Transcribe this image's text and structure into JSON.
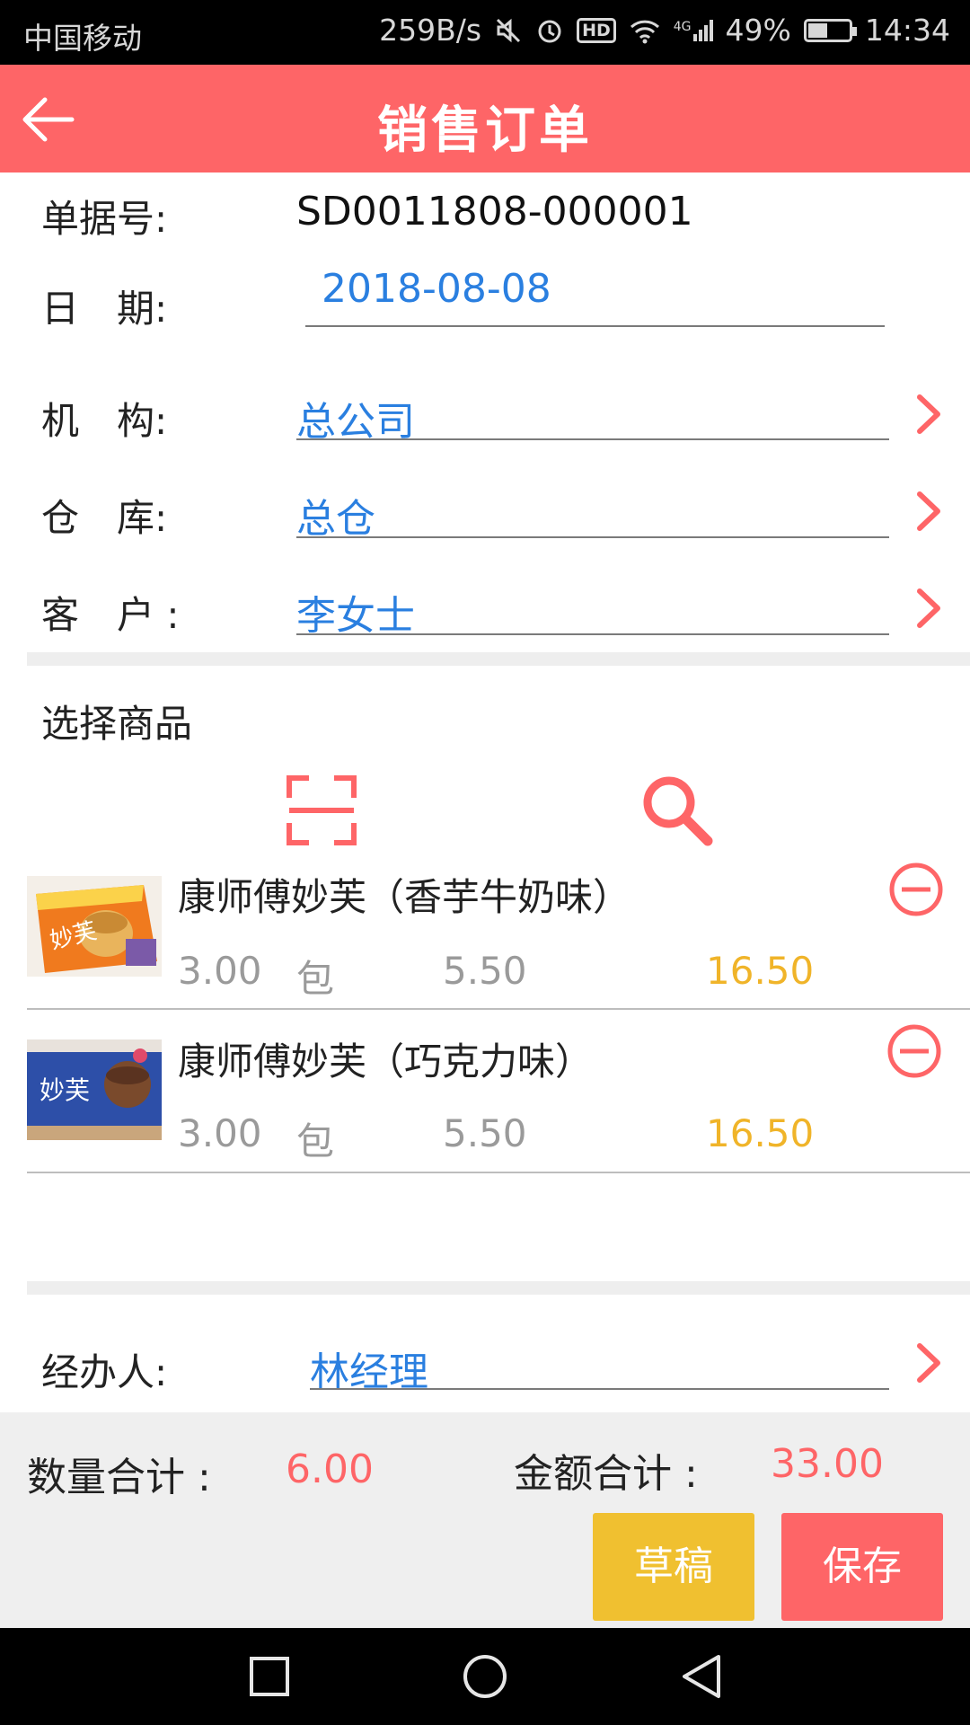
{
  "status_bar": {
    "carrier": "中国移动",
    "net_speed": "259B/s",
    "hd": "HD",
    "signal_type": "4G",
    "battery": "49%",
    "time": "14:34"
  },
  "header": {
    "title": "销售订单"
  },
  "form": {
    "doc_no_label": "单据号:",
    "doc_no_value": "SD0011808-000001",
    "date_label": "日　期:",
    "date_value": "2018-08-08",
    "org_label": "机　构:",
    "org_value": "总公司",
    "warehouse_label": "仓　库:",
    "warehouse_value": "总仓",
    "customer_label": "客　户 :",
    "customer_value": "李女士"
  },
  "goods": {
    "section_label": "选择商品",
    "items": [
      {
        "name": "康师傅妙芙（香芋牛奶味）",
        "qty": "3.00",
        "unit": "包",
        "price": "5.50",
        "amount": "16.50",
        "image_text": "妙芙"
      },
      {
        "name": "康师傅妙芙（巧克力味）",
        "qty": "3.00",
        "unit": "包",
        "price": "5.50",
        "amount": "16.50",
        "image_text": "妙芙"
      }
    ]
  },
  "handler": {
    "label": "经办人:",
    "value": "林经理"
  },
  "totals": {
    "qty_label": "数量合计 :",
    "qty_value": "6.00",
    "amount_label": "金额合计 :",
    "amount_value": "33.00"
  },
  "actions": {
    "draft_label": "草稿",
    "save_label": "保存"
  },
  "colors": {
    "brand": "#fe6567",
    "link_blue": "#2a7fe0",
    "amount_yellow": "#f0b429",
    "draft_button": "#f0c030"
  },
  "icons": [
    "back-arrow-icon",
    "chevron-right-icon",
    "scan-icon",
    "search-icon",
    "remove-icon",
    "nav-square-icon",
    "nav-circle-icon",
    "nav-triangle-icon"
  ]
}
